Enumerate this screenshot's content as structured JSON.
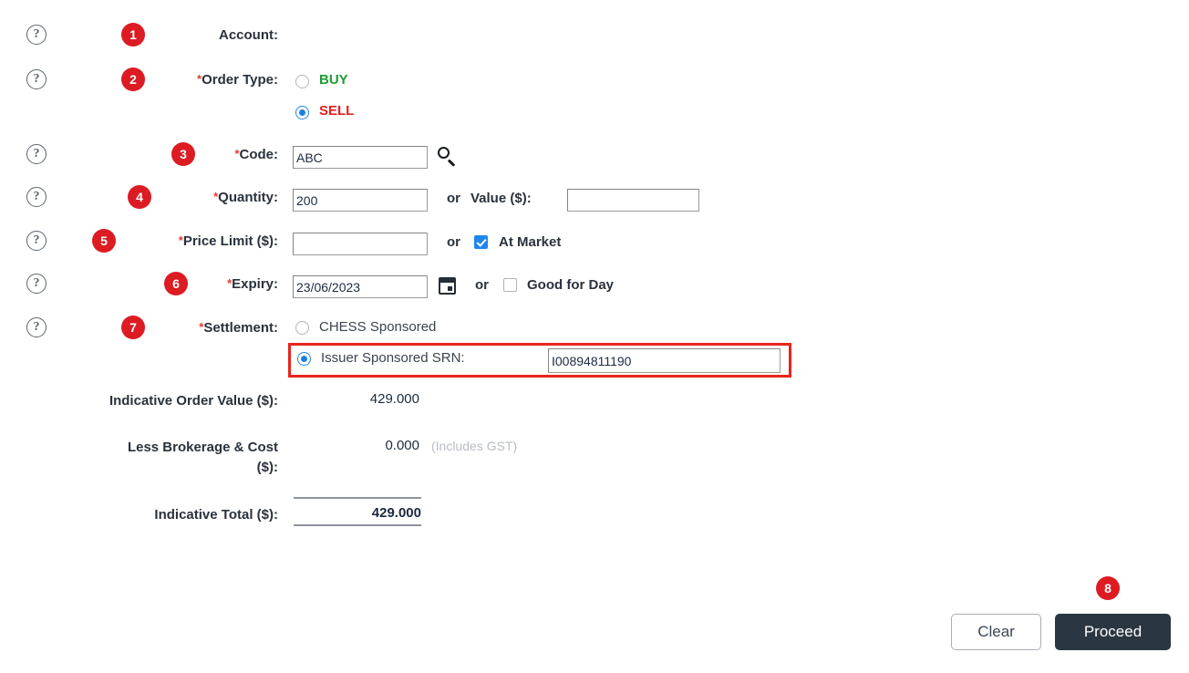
{
  "form": {
    "rows": [
      {
        "badge": "1",
        "help": "?",
        "label": "Account:",
        "required": false
      },
      {
        "badge": "2",
        "help": "?",
        "label": "Order Type:",
        "required": true,
        "options": [
          {
            "text": "BUY",
            "selected": false
          },
          {
            "text": "SELL",
            "selected": true
          }
        ]
      },
      {
        "badge": "3",
        "help": "?",
        "label": "Code:",
        "required": true,
        "value": "ABC",
        "icon": "search-icon"
      },
      {
        "badge": "4",
        "help": "?",
        "label": "Quantity:",
        "required": true,
        "value": "200",
        "or": "or",
        "second_label": "Value ($):",
        "second_value": ""
      },
      {
        "badge": "5",
        "help": "?",
        "label": "Price Limit ($):",
        "required": true,
        "value": "",
        "or": "or",
        "checkbox_label": "At Market",
        "checkbox_checked": true
      },
      {
        "badge": "6",
        "help": "?",
        "label": "Expiry:",
        "required": true,
        "value": "23/06/2023",
        "icon": "calendar-icon",
        "or": "or",
        "checkbox_label": "Good for Day",
        "checkbox_checked": false
      },
      {
        "badge": "7",
        "help": "?",
        "label": "Settlement:",
        "required": true,
        "options": [
          {
            "text": "CHESS Sponsored",
            "selected": false
          },
          {
            "text": "Issuer Sponsored SRN:",
            "selected": true
          }
        ],
        "srn_value": "I00894811190"
      }
    ]
  },
  "totals": {
    "order_value_label": "Indicative Order Value ($):",
    "order_value": "429.000",
    "brokerage_label_line1": "Less Brokerage & Cost",
    "brokerage_label_line2": "($):",
    "brokerage_value": "0.000",
    "brokerage_note": "(Includes GST)",
    "total_label": "Indicative Total ($):",
    "total_value": "429.000"
  },
  "actions": {
    "clear_label": "Clear",
    "proceed_label": "Proceed",
    "proceed_badge": "8"
  },
  "colors": {
    "badge_red": "#dd1b23",
    "highlight_red": "#e8251d",
    "buy_green": "#1d9c34",
    "sell_red": "#e02020",
    "accent_blue": "#1a7fe0",
    "proceed_dark": "#2b3643"
  }
}
